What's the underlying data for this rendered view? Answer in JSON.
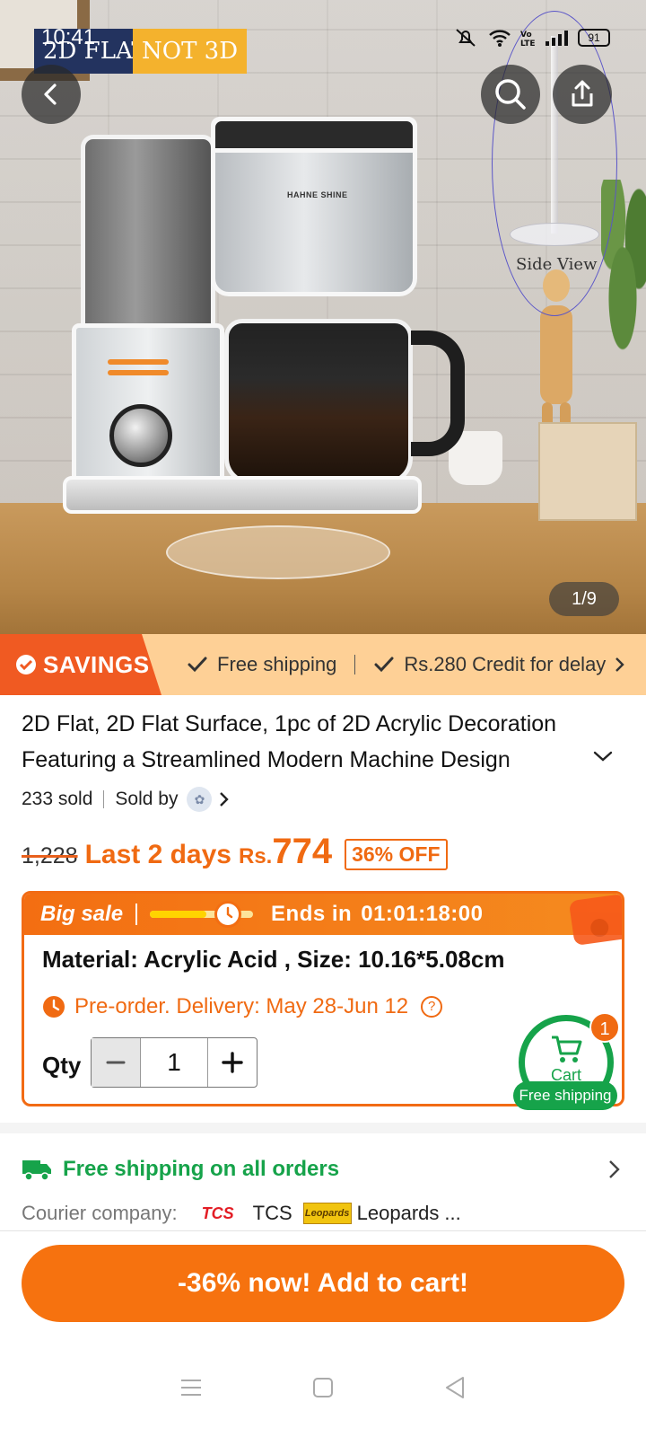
{
  "status_bar": {
    "time": "10:41",
    "battery": "91"
  },
  "hero": {
    "tag_left": "2D FLAT",
    "tag_right": "NOT 3D",
    "brand": "HAHNE SHINE",
    "side_label": "Side View",
    "page_counter": "1/9"
  },
  "savings": {
    "badge": "SAVINGS",
    "perk_1": "Free shipping",
    "perk_2": "Rs.280 Credit for delay"
  },
  "product": {
    "title": "2D Flat, 2D Flat Surface, 1pc of 2D Acrylic Decoration Featuring a Streamlined Modern Machine Design",
    "sold": "233 sold",
    "sold_by": "Sold by",
    "old_price": "1,228",
    "promo_text": "Last 2 days",
    "currency": "Rs.",
    "price": "774",
    "off": "36% OFF"
  },
  "sale": {
    "label": "Big sale",
    "progress": 0.55,
    "ends_in": "Ends in",
    "countdown": "01:01:18:00",
    "material": "Material: Acrylic Acid , Size: 10.16*5.08cm",
    "preorder": "Pre-order. Delivery: May 28-Jun 12",
    "qty_label": "Qty",
    "qty_value": "1"
  },
  "cart": {
    "label": "Cart",
    "count": "1",
    "shipping": "Free shipping"
  },
  "shipping": {
    "title": "Free shipping on all orders",
    "courier_label": "Courier company:",
    "courier_1_logo": "TCS",
    "courier_1": "TCS",
    "courier_2_logo": "Leopards",
    "courier_2": "Leopards",
    "more": "..."
  },
  "cta": {
    "label": "-36% now! Add to cart!"
  },
  "colors": {
    "accent": "#f6720f",
    "green": "#16a34a",
    "savings_bg": "#fed096"
  },
  "icons": [
    "back-icon",
    "search-icon",
    "share-icon",
    "chevron-down-icon",
    "chevron-right-icon",
    "clock-icon",
    "help-icon",
    "cart-icon",
    "truck-icon",
    "menu-icon",
    "home-icon",
    "back-triangle-icon"
  ]
}
